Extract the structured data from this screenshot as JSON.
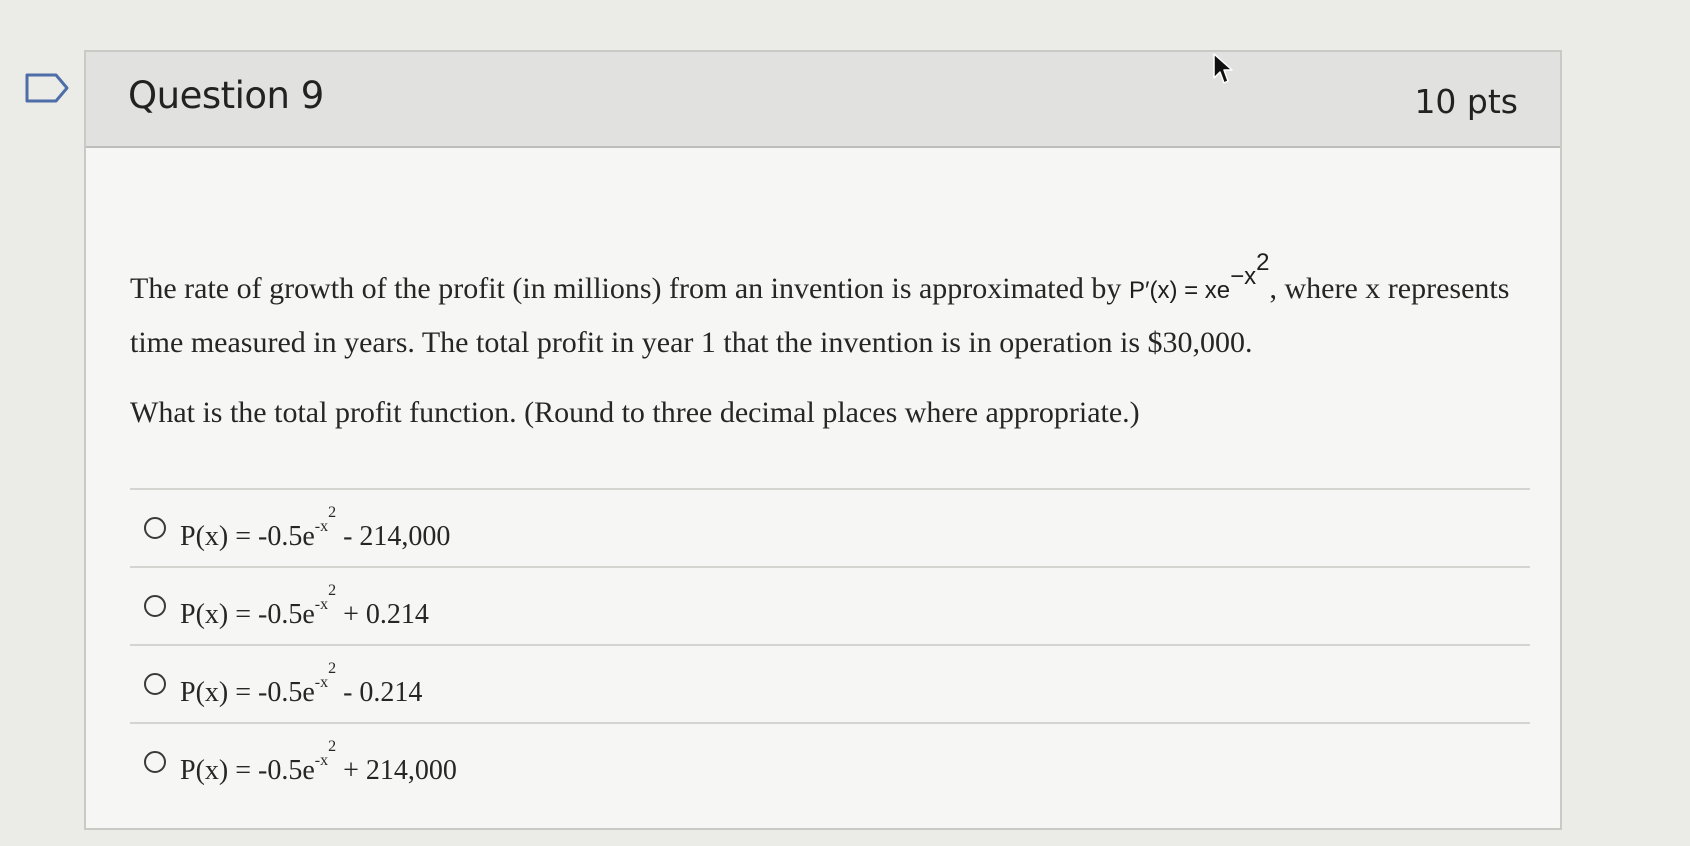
{
  "question": {
    "title": "Question 9",
    "points": "10 pts",
    "text_part1": "The rate of growth of the profit (in millions) from an invention is approximated by ",
    "formula_base": "P′(x) = xe",
    "formula_exp": "−x",
    "formula_exp_power": "2",
    "text_part2": ", where x represents time measured in years. The total profit in year 1 that the invention is in operation is $30,000.",
    "prompt": "What is the total profit function. (Round to three decimal places where appropriate.)"
  },
  "answers": [
    {
      "prefix": "P(x) = -0.5e",
      "exp": "-x",
      "power": "2",
      "suffix": " - 214,000"
    },
    {
      "prefix": "P(x) = -0.5e",
      "exp": "-x",
      "power": "2",
      "suffix": " + 0.214"
    },
    {
      "prefix": "P(x) = -0.5e",
      "exp": "-x",
      "power": "2",
      "suffix": " - 0.214"
    },
    {
      "prefix": "P(x) = -0.5e",
      "exp": "-x",
      "power": "2",
      "suffix": " + 214,000"
    }
  ]
}
